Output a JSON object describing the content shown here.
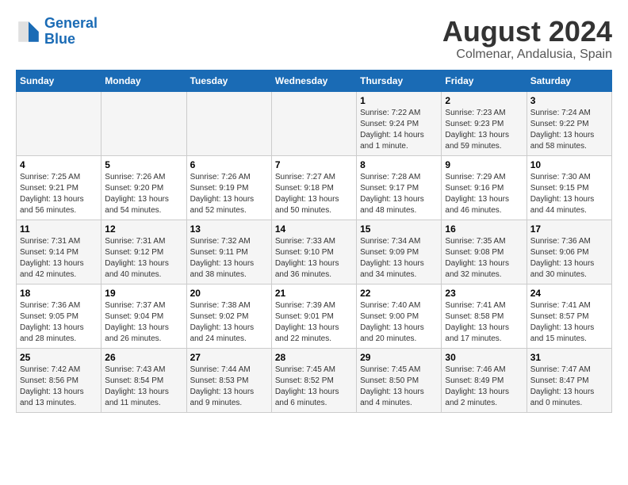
{
  "logo": {
    "line1": "General",
    "line2": "Blue"
  },
  "title": "August 2024",
  "subtitle": "Colmenar, Andalusia, Spain",
  "weekdays": [
    "Sunday",
    "Monday",
    "Tuesday",
    "Wednesday",
    "Thursday",
    "Friday",
    "Saturday"
  ],
  "weeks": [
    [
      {
        "day": "",
        "info": ""
      },
      {
        "day": "",
        "info": ""
      },
      {
        "day": "",
        "info": ""
      },
      {
        "day": "",
        "info": ""
      },
      {
        "day": "1",
        "info": "Sunrise: 7:22 AM\nSunset: 9:24 PM\nDaylight: 14 hours and 1 minute."
      },
      {
        "day": "2",
        "info": "Sunrise: 7:23 AM\nSunset: 9:23 PM\nDaylight: 13 hours and 59 minutes."
      },
      {
        "day": "3",
        "info": "Sunrise: 7:24 AM\nSunset: 9:22 PM\nDaylight: 13 hours and 58 minutes."
      }
    ],
    [
      {
        "day": "4",
        "info": "Sunrise: 7:25 AM\nSunset: 9:21 PM\nDaylight: 13 hours and 56 minutes."
      },
      {
        "day": "5",
        "info": "Sunrise: 7:26 AM\nSunset: 9:20 PM\nDaylight: 13 hours and 54 minutes."
      },
      {
        "day": "6",
        "info": "Sunrise: 7:26 AM\nSunset: 9:19 PM\nDaylight: 13 hours and 52 minutes."
      },
      {
        "day": "7",
        "info": "Sunrise: 7:27 AM\nSunset: 9:18 PM\nDaylight: 13 hours and 50 minutes."
      },
      {
        "day": "8",
        "info": "Sunrise: 7:28 AM\nSunset: 9:17 PM\nDaylight: 13 hours and 48 minutes."
      },
      {
        "day": "9",
        "info": "Sunrise: 7:29 AM\nSunset: 9:16 PM\nDaylight: 13 hours and 46 minutes."
      },
      {
        "day": "10",
        "info": "Sunrise: 7:30 AM\nSunset: 9:15 PM\nDaylight: 13 hours and 44 minutes."
      }
    ],
    [
      {
        "day": "11",
        "info": "Sunrise: 7:31 AM\nSunset: 9:14 PM\nDaylight: 13 hours and 42 minutes."
      },
      {
        "day": "12",
        "info": "Sunrise: 7:31 AM\nSunset: 9:12 PM\nDaylight: 13 hours and 40 minutes."
      },
      {
        "day": "13",
        "info": "Sunrise: 7:32 AM\nSunset: 9:11 PM\nDaylight: 13 hours and 38 minutes."
      },
      {
        "day": "14",
        "info": "Sunrise: 7:33 AM\nSunset: 9:10 PM\nDaylight: 13 hours and 36 minutes."
      },
      {
        "day": "15",
        "info": "Sunrise: 7:34 AM\nSunset: 9:09 PM\nDaylight: 13 hours and 34 minutes."
      },
      {
        "day": "16",
        "info": "Sunrise: 7:35 AM\nSunset: 9:08 PM\nDaylight: 13 hours and 32 minutes."
      },
      {
        "day": "17",
        "info": "Sunrise: 7:36 AM\nSunset: 9:06 PM\nDaylight: 13 hours and 30 minutes."
      }
    ],
    [
      {
        "day": "18",
        "info": "Sunrise: 7:36 AM\nSunset: 9:05 PM\nDaylight: 13 hours and 28 minutes."
      },
      {
        "day": "19",
        "info": "Sunrise: 7:37 AM\nSunset: 9:04 PM\nDaylight: 13 hours and 26 minutes."
      },
      {
        "day": "20",
        "info": "Sunrise: 7:38 AM\nSunset: 9:02 PM\nDaylight: 13 hours and 24 minutes."
      },
      {
        "day": "21",
        "info": "Sunrise: 7:39 AM\nSunset: 9:01 PM\nDaylight: 13 hours and 22 minutes."
      },
      {
        "day": "22",
        "info": "Sunrise: 7:40 AM\nSunset: 9:00 PM\nDaylight: 13 hours and 20 minutes."
      },
      {
        "day": "23",
        "info": "Sunrise: 7:41 AM\nSunset: 8:58 PM\nDaylight: 13 hours and 17 minutes."
      },
      {
        "day": "24",
        "info": "Sunrise: 7:41 AM\nSunset: 8:57 PM\nDaylight: 13 hours and 15 minutes."
      }
    ],
    [
      {
        "day": "25",
        "info": "Sunrise: 7:42 AM\nSunset: 8:56 PM\nDaylight: 13 hours and 13 minutes."
      },
      {
        "day": "26",
        "info": "Sunrise: 7:43 AM\nSunset: 8:54 PM\nDaylight: 13 hours and 11 minutes."
      },
      {
        "day": "27",
        "info": "Sunrise: 7:44 AM\nSunset: 8:53 PM\nDaylight: 13 hours and 9 minutes."
      },
      {
        "day": "28",
        "info": "Sunrise: 7:45 AM\nSunset: 8:52 PM\nDaylight: 13 hours and 6 minutes."
      },
      {
        "day": "29",
        "info": "Sunrise: 7:45 AM\nSunset: 8:50 PM\nDaylight: 13 hours and 4 minutes."
      },
      {
        "day": "30",
        "info": "Sunrise: 7:46 AM\nSunset: 8:49 PM\nDaylight: 13 hours and 2 minutes."
      },
      {
        "day": "31",
        "info": "Sunrise: 7:47 AM\nSunset: 8:47 PM\nDaylight: 13 hours and 0 minutes."
      }
    ]
  ],
  "accent_color": "#1a6bb5"
}
